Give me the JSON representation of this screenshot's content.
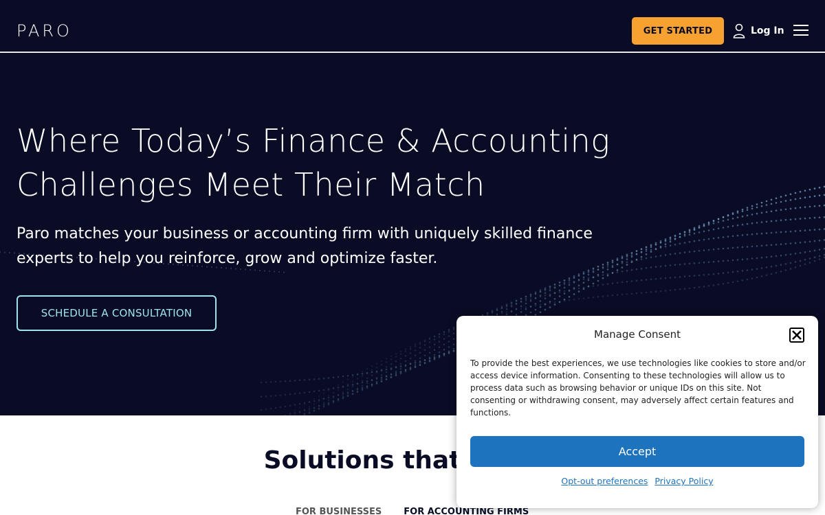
{
  "header": {
    "logo": "PARO",
    "get_started": "GET STARTED",
    "login": "Log In"
  },
  "hero": {
    "title_line1": "Where Today’s Finance & Accounting",
    "title_line2": "Challenges Meet Their Match",
    "subtitle_line1": "Paro matches your business or accounting firm with uniquely skilled finance",
    "subtitle_line2": "experts to help you reinforce, grow and optimize faster.",
    "cta": "SCHEDULE A CONSULTATION"
  },
  "solutions": {
    "title": "Solutions that Bridge",
    "tabs": [
      "FOR BUSINESSES",
      "FOR ACCOUNTING FIRMS"
    ]
  },
  "consent": {
    "title": "Manage Consent",
    "body": "To provide the best experiences, we use technologies like cookies to store and/or access device information. Consenting to these technologies will allow us to process data such as browsing behavior or unique IDs on this site. Not consenting or withdrawing consent, may adversely affect certain features and functions.",
    "accept": "Accept",
    "opt_out": "Opt-out preferences",
    "privacy": "Privacy Policy"
  },
  "colors": {
    "navy": "#0a0c26",
    "orange": "#f7a230",
    "teal": "#9fe3ec",
    "blue": "#1e73be"
  }
}
